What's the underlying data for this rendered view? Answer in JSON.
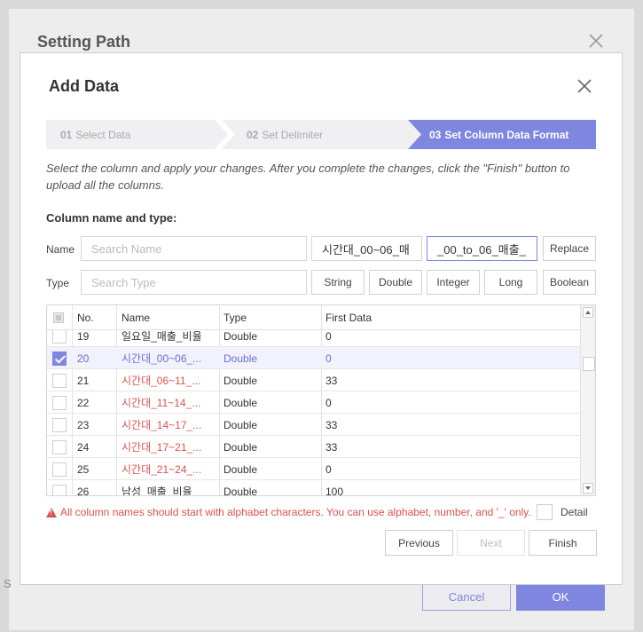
{
  "background": {
    "title": "Setting Path",
    "side_text": "S",
    "cancel_label": "Cancel",
    "ok_label": "OK"
  },
  "dialog": {
    "title": "Add Data",
    "steps": [
      {
        "num": "01",
        "label": "Select Data",
        "active": false
      },
      {
        "num": "02",
        "label": "Set Delimiter",
        "active": false
      },
      {
        "num": "03",
        "label": "Set Column Data Format",
        "active": true
      }
    ],
    "description": "Select the column and apply your changes. After you complete the changes, click the \"Finish\" button to upload all the columns.",
    "section_title": "Column name and type:",
    "name_label": "Name",
    "name_search_placeholder": "Search Name",
    "find_value": "시간대_00~06_매",
    "replace_value": "_00_to_06_매출_",
    "replace_button": "Replace",
    "type_label": "Type",
    "type_search_placeholder": "Search Type",
    "type_buttons": [
      "String",
      "Double",
      "Integer",
      "Long",
      "Boolean"
    ],
    "table": {
      "headers": [
        "No.",
        "Name",
        "Type",
        "First Data"
      ],
      "rows": [
        {
          "no": "19",
          "name": "일요일_매출_비율",
          "type": "Double",
          "first": "0",
          "checked": false,
          "invalid": false
        },
        {
          "no": "20",
          "name": "시간대_00~06_...",
          "type": "Double",
          "first": "0",
          "checked": true,
          "invalid": true
        },
        {
          "no": "21",
          "name": "시간대_06~11_...",
          "type": "Double",
          "first": "33",
          "checked": false,
          "invalid": true
        },
        {
          "no": "22",
          "name": "시간대_11~14_...",
          "type": "Double",
          "first": "0",
          "checked": false,
          "invalid": true
        },
        {
          "no": "23",
          "name": "시간대_14~17_...",
          "type": "Double",
          "first": "33",
          "checked": false,
          "invalid": true
        },
        {
          "no": "24",
          "name": "시간대_17~21_...",
          "type": "Double",
          "first": "33",
          "checked": false,
          "invalid": true
        },
        {
          "no": "25",
          "name": "시간대_21~24_...",
          "type": "Double",
          "first": "0",
          "checked": false,
          "invalid": true
        },
        {
          "no": "26",
          "name": "남성_매출_비율",
          "type": "Double",
          "first": "100",
          "checked": false,
          "invalid": false
        }
      ]
    },
    "warning": "All column names should start with alphabet characters. You can use alphabet, number, and '_' only.",
    "detail_label": "Detail",
    "previous_label": "Previous",
    "next_label": "Next",
    "finish_label": "Finish"
  },
  "colors": {
    "accent": "#7f86e0",
    "error": "#d9534f"
  }
}
